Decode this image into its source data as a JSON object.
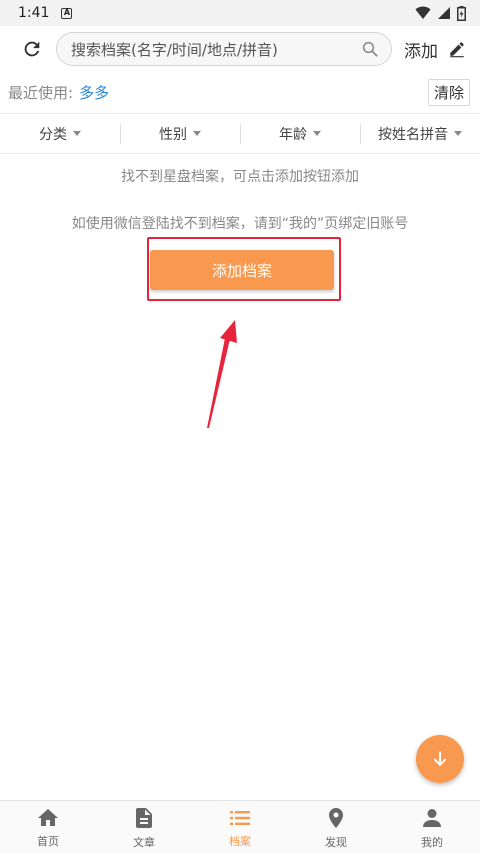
{
  "status_bar": {
    "time": "1:41",
    "notification_badge": "A"
  },
  "toolbar": {
    "search_placeholder": "搜索档案(名字/时间/地点/拼音)",
    "add_label": "添加"
  },
  "recent": {
    "label": "最近使用:",
    "items": [
      "多多"
    ],
    "clear_label": "清除"
  },
  "filters": [
    {
      "label": "分类"
    },
    {
      "label": "性别"
    },
    {
      "label": "年龄"
    },
    {
      "label": "按姓名拼音"
    }
  ],
  "empty_state": {
    "message": "找不到星盘档案，可点击添加按钮添加",
    "wechat_hint": "如使用微信登陆找不到档案，请到“我的”页绑定旧账号",
    "add_button_label": "添加档案"
  },
  "bottom_nav": [
    {
      "label": "首页",
      "icon": "home-icon"
    },
    {
      "label": "文章",
      "icon": "document-icon"
    },
    {
      "label": "档案",
      "icon": "list-icon",
      "active": true
    },
    {
      "label": "发现",
      "icon": "location-pin-icon"
    },
    {
      "label": "我的",
      "icon": "person-icon"
    }
  ],
  "colors": {
    "accent": "#f9994f",
    "link": "#2a87d8",
    "annotation_red": "#e8243c"
  }
}
